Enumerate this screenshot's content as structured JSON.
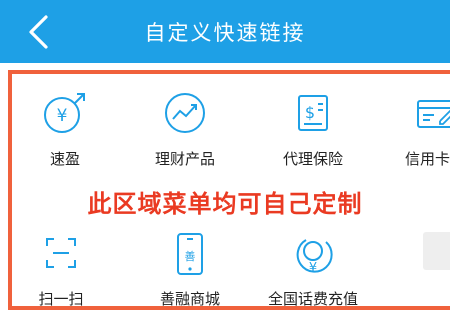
{
  "header": {
    "title": "自定义快速链接"
  },
  "grid": {
    "row1": [
      {
        "label": "速盈",
        "icon": "yuan-exchange-icon"
      },
      {
        "label": "理财产品",
        "icon": "trend-chart-icon"
      },
      {
        "label": "代理保险",
        "icon": "dollar-document-icon"
      },
      {
        "label": "信用卡申",
        "icon": "credit-card-icon"
      }
    ],
    "row2": [
      {
        "label": "扫一扫",
        "icon": "scan-icon"
      },
      {
        "label": "善融商城",
        "icon": "mobile-shop-icon"
      },
      {
        "label": "全国话费充值",
        "icon": "yuan-recharge-icon"
      }
    ]
  },
  "overlay": {
    "text": "此区域菜单均可自己定制"
  },
  "colors": {
    "header_bg": "#1ea0e6",
    "icon": "#1ea0e6",
    "frame_border": "#f0613c",
    "overlay_text": "#ea3a22"
  }
}
